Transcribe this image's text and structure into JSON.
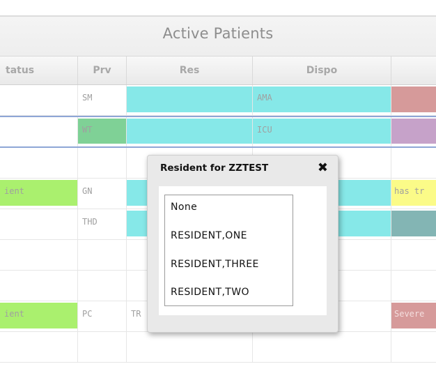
{
  "header": {
    "title": "Active Patients"
  },
  "columns": [
    "tatus",
    "Prv",
    "Res",
    "Dispo",
    ""
  ],
  "colors": {
    "cyan": "#86e8e8",
    "green_light": "#aaf06e",
    "prv_green": "#7fd196",
    "rose": "#d69a9a",
    "mauve": "#c6a2c9",
    "teal": "#83b5b4",
    "yellow": "#fbfb88"
  },
  "rows": [
    {
      "status": "",
      "prv": "SM",
      "res": "",
      "dispo": "AMA",
      "last": ""
    },
    {
      "status": "",
      "prv": "WT",
      "res": "",
      "dispo": "ICU",
      "last": ""
    },
    {
      "status": "",
      "prv": "",
      "res": "",
      "dispo": "",
      "last": ""
    },
    {
      "status": "ient",
      "prv": "GN",
      "res": "",
      "dispo": "",
      "last": "has tr"
    },
    {
      "status": "",
      "prv": "THD",
      "res": "",
      "dispo": "",
      "last": ""
    },
    {
      "status": "",
      "prv": "",
      "res": "",
      "dispo": "",
      "last": ""
    },
    {
      "status": "",
      "prv": "",
      "res": "",
      "dispo": "",
      "last": ""
    },
    {
      "status": "ient",
      "prv": "PC",
      "res": "TR",
      "dispo": "",
      "last": "Severe"
    },
    {
      "status": "",
      "prv": "",
      "res": "",
      "dispo": "",
      "last": ""
    }
  ],
  "popup": {
    "title": "Resident for ZZTEST",
    "close_icon": "✖",
    "options": [
      "None",
      "RESIDENT,ONE",
      "RESIDENT,THREE",
      "RESIDENT,TWO"
    ]
  }
}
